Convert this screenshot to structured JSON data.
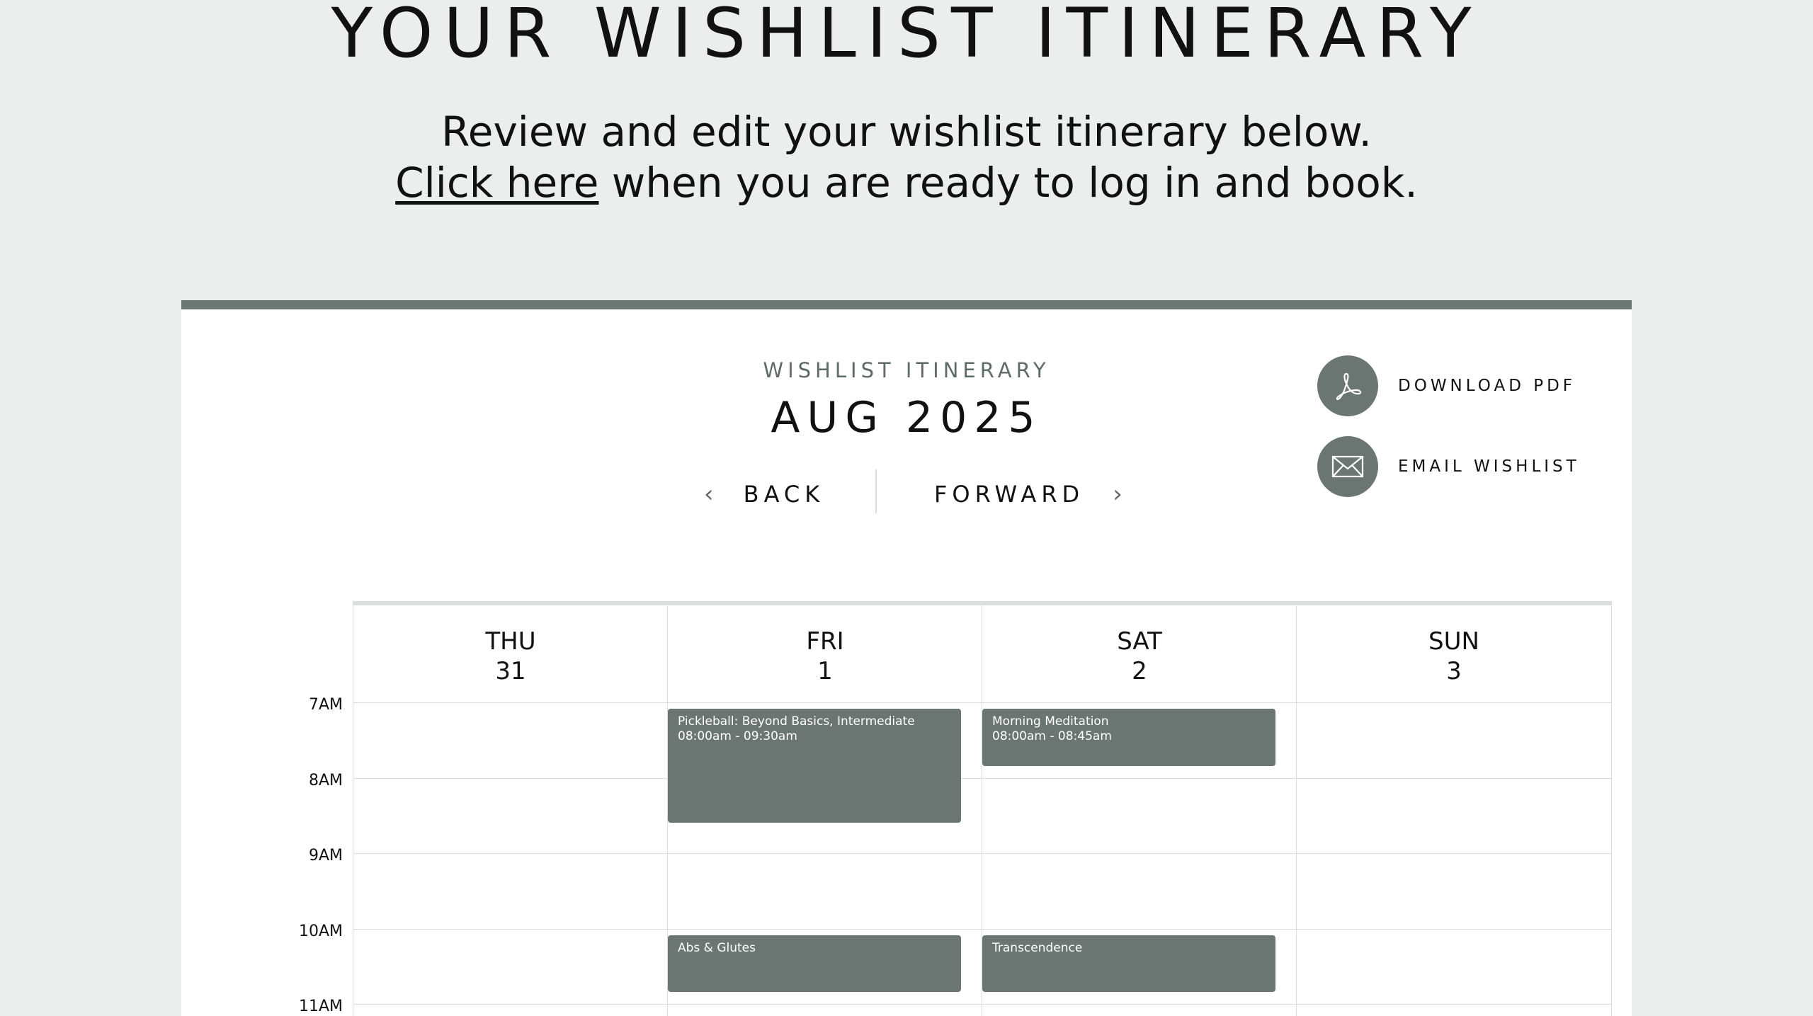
{
  "header": {
    "title": "YOUR WISHLIST ITINERARY",
    "intro_line1": "Review and edit your wishlist itinerary below.",
    "intro_link": "Click here",
    "intro_line2_rest": " when you are ready to log in and book."
  },
  "itinerary": {
    "subtitle": "WISHLIST ITINERARY",
    "month": "AUG 2025",
    "back_label": "BACK",
    "forward_label": "FORWARD",
    "download_label": "DOWNLOAD PDF",
    "email_label": "EMAIL WISHLIST"
  },
  "calendar": {
    "days": [
      {
        "name": "THU",
        "date": "31"
      },
      {
        "name": "FRI",
        "date": "1"
      },
      {
        "name": "SAT",
        "date": "2"
      },
      {
        "name": "SUN",
        "date": "3"
      }
    ],
    "times": [
      "7AM",
      "8AM",
      "9AM",
      "10AM",
      "11AM"
    ],
    "events": [
      {
        "title": "Pickleball: Beyond Basics, Intermediate",
        "time": "08:00am - 09:30am"
      },
      {
        "title": "Morning Meditation",
        "time": "08:00am - 08:45am"
      },
      {
        "title": "Abs & Glutes",
        "time": ""
      },
      {
        "title": "Transcendence",
        "time": ""
      }
    ]
  },
  "colors": {
    "accent": "#6b7673",
    "background": "#ebeeed",
    "card": "#ffffff"
  }
}
